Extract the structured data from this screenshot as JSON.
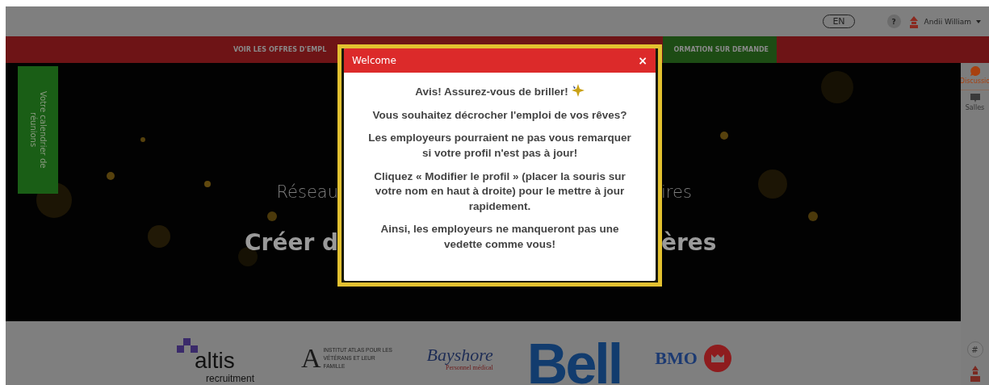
{
  "top_bar": {
    "language": "EN",
    "help": "?",
    "user_name": "Andii William"
  },
  "nav": [
    {
      "label": "VOIR LES OFFRES D'EMPL",
      "kind": "plain"
    },
    {
      "label": "ORMATION SUR DEMANDE",
      "kind": "highlight"
    }
  ],
  "calendar_button": "Votre calendrier de réunions",
  "hero": {
    "subtitle_left": "Réseau",
    "subtitle_right": "ires",
    "title_left": "Créer d",
    "title_right": "ères"
  },
  "modal": {
    "title": "Welcome",
    "close": "×",
    "paragraphs": [
      {
        "text": "Avis! Assurez-vous de briller!",
        "has_icon": true
      },
      {
        "text": "Vous souhaitez décrocher l'emploi de vos rêves?",
        "has_icon": false
      },
      {
        "text": "Les employeurs pourraient ne pas vous remarquer si votre profil n'est pas à jour!",
        "has_icon": false
      },
      {
        "text": "Cliquez « Modifier le profil » (placer la souris sur votre nom en haut à droite) pour le mettre à jour rapidement.",
        "has_icon": false
      },
      {
        "text": "Ainsi, les employeurs ne manqueront pas une vedette comme vous!",
        "has_icon": false
      }
    ]
  },
  "sidebar": [
    {
      "label": "Discussio",
      "selected": true
    },
    {
      "label": "Salles",
      "selected": false
    }
  ],
  "sidebar_bottom": {
    "hashtag": "#"
  },
  "sponsors": [
    {
      "kind": "altis",
      "name": "altis",
      "sub": "recruitment"
    },
    {
      "kind": "atlas",
      "name": "A",
      "sub": "INSTITUT ATLAS POUR LES VÉTÉRANS ET LEUR FAMILLE"
    },
    {
      "kind": "bayshore",
      "name": "Bayshore",
      "sub": "Personnel médical"
    },
    {
      "kind": "bell",
      "name": "Bell"
    },
    {
      "kind": "bmo",
      "name": "BMO"
    }
  ]
}
